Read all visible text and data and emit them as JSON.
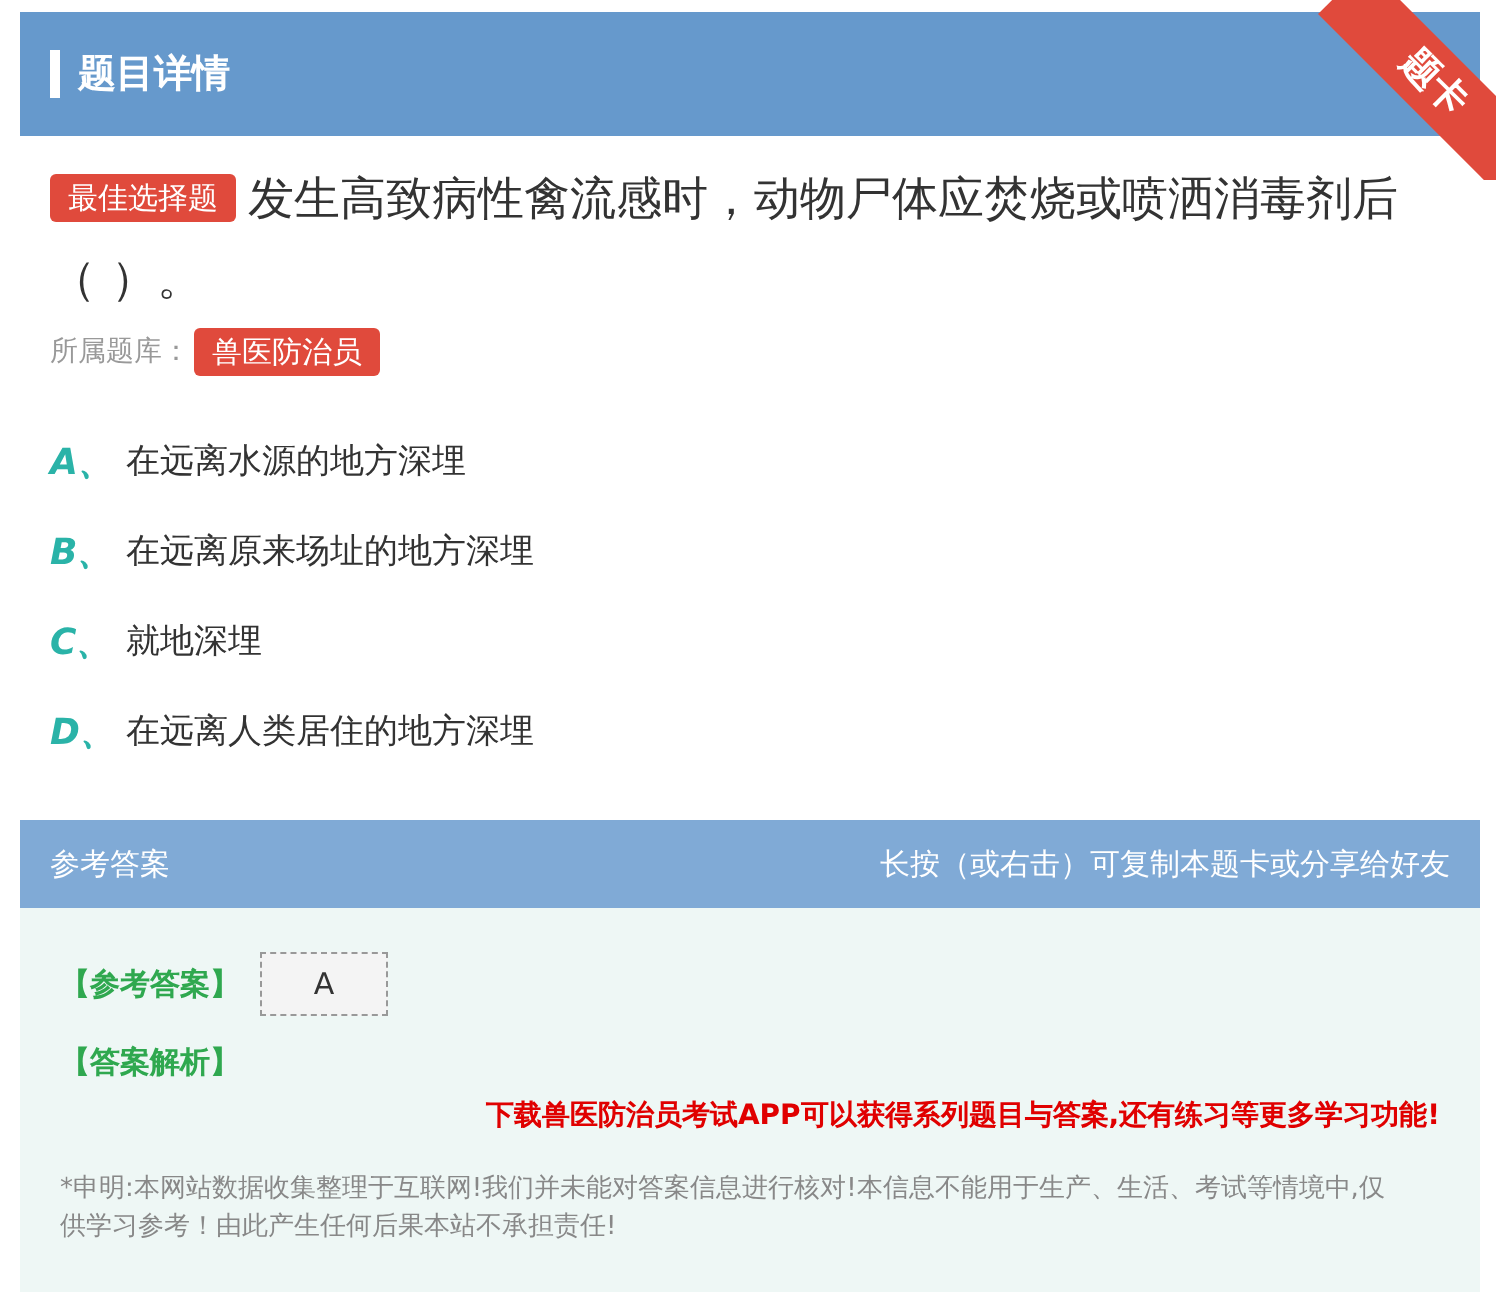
{
  "header": {
    "title": "题目详情",
    "ribbon": "题卡"
  },
  "question": {
    "type_badge": "最佳选择题",
    "text": "发生高致病性禽流感时，动物尸体应焚烧或喷洒消毒剂后（ ）。",
    "bank_label": "所属题库：",
    "bank": "兽医防治员"
  },
  "options": [
    {
      "letter": "A、",
      "text": "在远离水源的地方深埋"
    },
    {
      "letter": "B、",
      "text": "在远离原来场址的地方深埋"
    },
    {
      "letter": "C、",
      "text": "就地深埋"
    },
    {
      "letter": "D、",
      "text": "在远离人类居住的地方深埋"
    }
  ],
  "answer_bar": {
    "title": "参考答案",
    "hint": "长按（或右击）可复制本题卡或分享给好友"
  },
  "answer": {
    "label": "【参考答案】",
    "value": "A",
    "analysis_label": "【答案解析】",
    "promo": "下载兽医防治员考试APP可以获得系列题目与答案,还有练习等更多学习功能!",
    "disclaimer": "*申明:本网站数据收集整理于互联网!我们并未能对答案信息进行核对!本信息不能用于生产、生活、考试等情境中,仅供学习参考！由此产生任何后果本站不承担责任!"
  }
}
